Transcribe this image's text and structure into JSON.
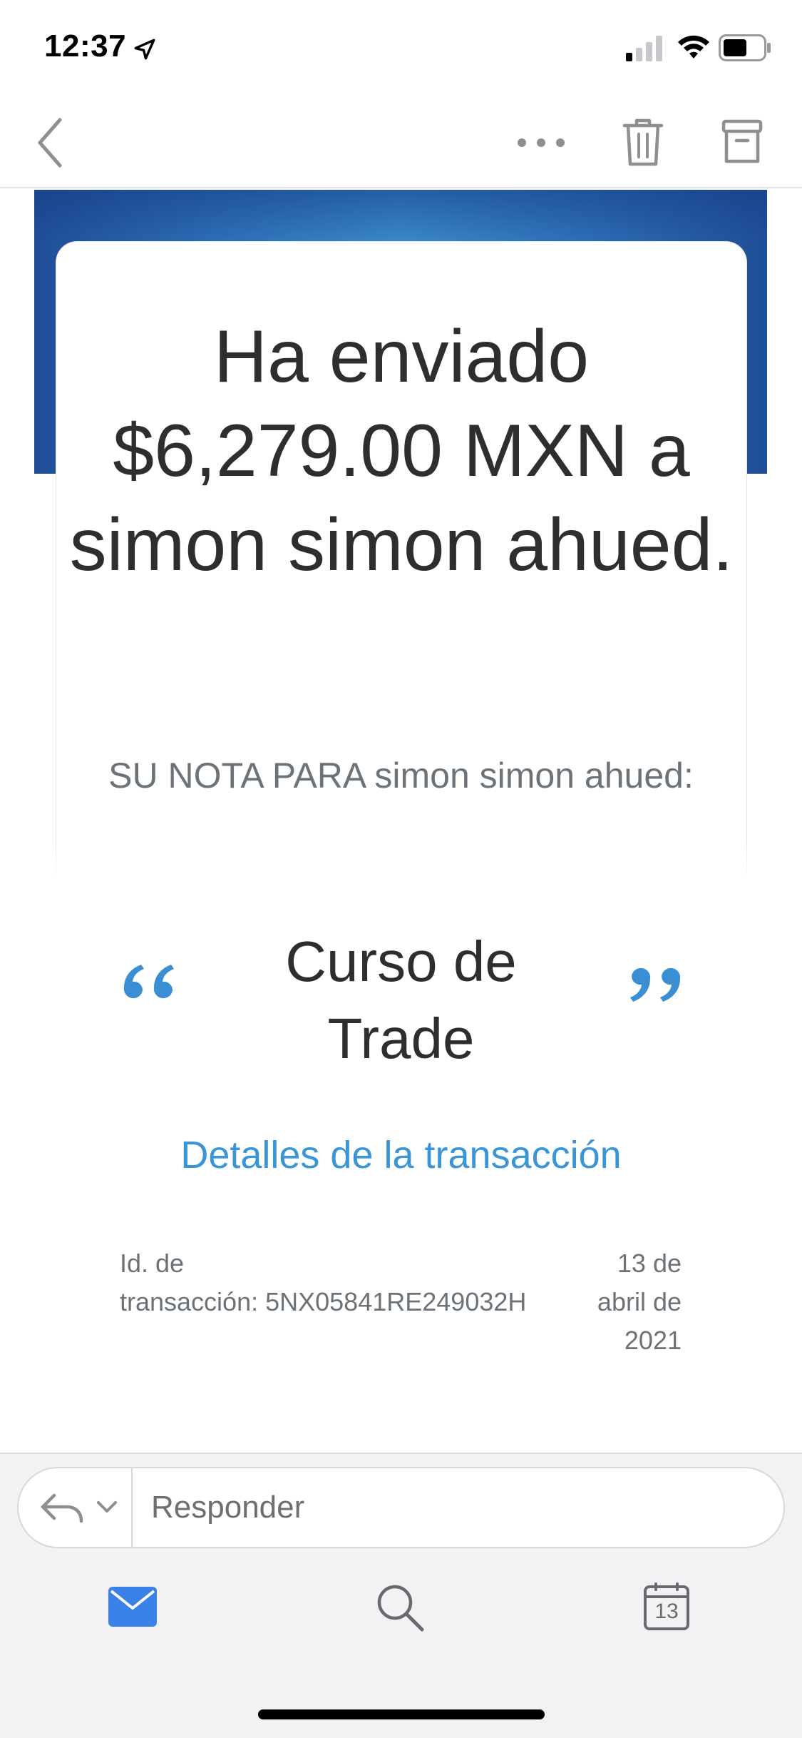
{
  "status_bar": {
    "time": "12:37"
  },
  "toolbar": {
    "icons": [
      "back-chevron-icon",
      "more-icon",
      "trash-icon",
      "archive-icon"
    ]
  },
  "email": {
    "headline": "Ha enviado $6,279.00 MXN a simon simon ahued.",
    "note_heading": "SU NOTA PARA simon simon ahued:",
    "note_text": "Curso de Trade",
    "details_link": "Detalles de la transacción",
    "transaction_id_label": "Id. de",
    "transaction_id": "transacción: 5NX05841RE249032H",
    "date_line1": "13 de",
    "date_line2": "abril de",
    "date_line3": "2021"
  },
  "reply": {
    "placeholder": "Responder"
  },
  "tabbar": {
    "calendar_day": "13"
  },
  "colors": {
    "link_blue": "#3a95d6",
    "banner_blue": "#1f4e97",
    "mail_tab_blue": "#3a82e8"
  }
}
